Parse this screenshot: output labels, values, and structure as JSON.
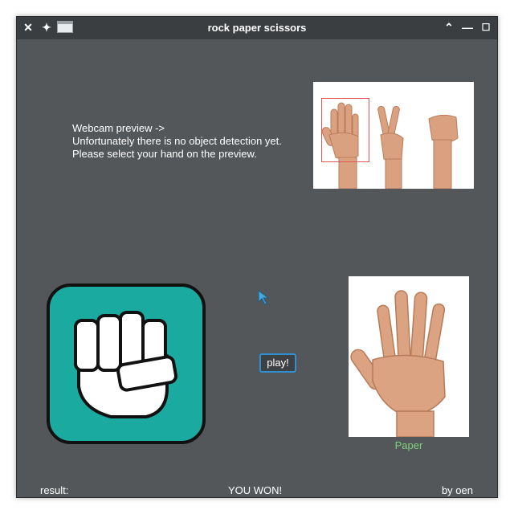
{
  "window": {
    "title": "rock paper scissors"
  },
  "titlebar": {
    "close_icon": "close-icon",
    "pin_icon": "pin-icon",
    "minimize_icon": "chevron-up-icon",
    "maximize_icon": "maximize-icon",
    "restore_icon": "square-icon"
  },
  "instructions": {
    "line1": "Webcam preview ->",
    "line2": "Unfortunately there is no object detection yet.",
    "line3": "Please select your hand on the preview."
  },
  "controls": {
    "play_label": "play!"
  },
  "computer_choice": {
    "label": "Paper",
    "label_color": "#7fd27f"
  },
  "player_choice": {
    "icon": "rock-fist-icon",
    "tile_color": "#1aaaa0"
  },
  "footer": {
    "result_label": "result:",
    "result_value": "YOU WON!",
    "credit": "by oen"
  }
}
